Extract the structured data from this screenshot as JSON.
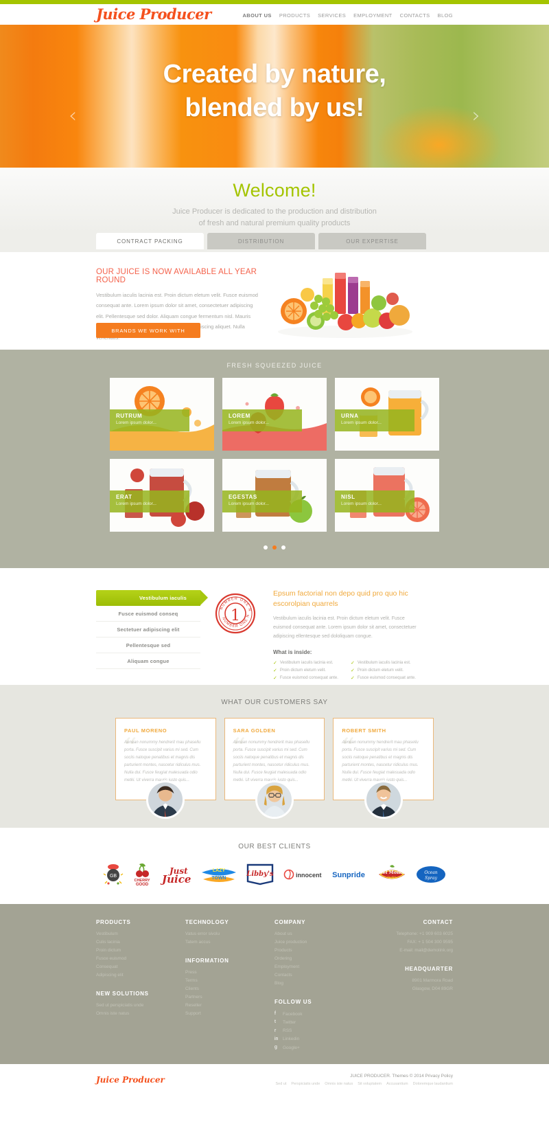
{
  "header": {
    "logo": "Juice Producer",
    "nav": [
      {
        "label": "ABOUT US",
        "active": true
      },
      {
        "label": "PRODUCTS"
      },
      {
        "label": "SERVICES"
      },
      {
        "label": "EMPLOYMENT"
      },
      {
        "label": "CONTACTS"
      },
      {
        "label": "BLOG"
      }
    ]
  },
  "hero": {
    "line1": "Created by nature,",
    "line2": "blended by us!",
    "prev": "‹",
    "next": "›"
  },
  "welcome": {
    "title": "Welcome!",
    "line1": "Juice Producer is dedicated to the production and distribution",
    "line2": "of fresh and natural premium quality products"
  },
  "tabs": [
    {
      "label": "CONTRACT PACKING",
      "active": true
    },
    {
      "label": "DISTRIBUTION",
      "active": false
    },
    {
      "label": "OUR EXPERTISE",
      "active": false
    }
  ],
  "intro": {
    "heading": "OUR JUICE IS NOW AVAILABLE ALL YEAR ROUND",
    "body": "Vestibulum iaculis lacinia est. Proin dictum eletum velit. Fusce euismod consequat ante. Lorem ipsum dolor sit amet, consectetuer adipiscing elit. Pellentesque sed dolor. Aliquam congue fermentum nisl. Mauris asan nulla vel diam. Sed in lacus ut enim adipiscing aliquet. Nulla venenatis.",
    "button": "BRANDS WE WORK WITH"
  },
  "gallery": {
    "title": "FRESH SQUEEZED JUICE",
    "items": [
      {
        "title": "RUTRUM",
        "sub": "Lorem ipsum dolor..."
      },
      {
        "title": "LOREM",
        "sub": "Lorem ipsum dolor..."
      },
      {
        "title": "URNA",
        "sub": "Lorem ipsum dolor..."
      },
      {
        "title": "ERAT",
        "sub": "Lorem ipsum dolor..."
      },
      {
        "title": "EGESTAS",
        "sub": "Lorem ipsum dolor..."
      },
      {
        "title": "NISL",
        "sub": "Lorem ipsum dolor..."
      }
    ],
    "dots": 3,
    "active_dot": 1
  },
  "features": {
    "list": [
      {
        "label": "Vestibulum iaculis",
        "active": true
      },
      {
        "label": "Fusce euismod conseq",
        "active": false
      },
      {
        "label": "Sectetuer adipiscing elit",
        "active": false
      },
      {
        "label": "Pellentesque sed",
        "active": false
      },
      {
        "label": "Aliquam congue",
        "active": false
      }
    ],
    "badge_number": "1",
    "badge_text": "NUMBER ONE",
    "heading": "Epsum factorial non depo quid pro quo hic escorolpian quarrels",
    "body": "Vestibulum iaculis lacinia est. Proin dictum eletum velit. Fusce euismod consequat ante. Lorem ipsum dolor sit amet, consectetuer adipiscing ellentesque sed dololiquam congue.",
    "inside_title": "What is inside:",
    "checks": [
      "Vestibulum iaculis lacinia est.",
      "Vestibulum iaculis lacinia est.",
      "Proin dictum eletum velit.",
      "Proin dictum eletum velit.",
      "Fusce euismod consequat ante.",
      "Fusce euismod consequat ante."
    ]
  },
  "testimonials": {
    "title": "WHAT OUR CUSTOMERS SAY",
    "items": [
      {
        "name": "PAUL MORENO",
        "text": "Aenean nonummy hendrerit mau phasellu porta. Fusce suscipit varius mi sed. Cum sociis natoque penatibus et magnis dis parturient montes, nascetur ridiculus mus. Nulla dui. Fusce feugiat malesuada odio metki. Ut viverra mauris justo quis..."
      },
      {
        "name": "SARA GOLDEN",
        "text": "Aenean nonummy hendrerit mau phasellu porta. Fusce suscipit varius mi sed. Cum sociis natoque penatibus et magnis dis parturient montes, nascetur ridiculus mus. Nulla dui. Fusce feugiat malesuada odio metki. Ut viverra mauris justo quis..."
      },
      {
        "name": "ROBERT SMITH",
        "text": "Aenean nonummy hendrerit mau phasellu porta. Fusce suscipit varius mi sed. Cum sociis natoque penatibus et magnis dis parturient montes, nascetur ridiculus mus. Nulla dui. Fusce feugiat malesuada odio metki. Ut viverra mauris justo quis..."
      }
    ]
  },
  "clients": {
    "title": "OUR BEST CLIENTS",
    "logos": [
      {
        "name": "GB"
      },
      {
        "name": "CHERRY GOOD"
      },
      {
        "name": "Just Juice"
      },
      {
        "name": "LAZY TOWN"
      },
      {
        "name": "Libby's"
      },
      {
        "name": "innocent"
      },
      {
        "name": "Sunpride"
      },
      {
        "name": "Del Monte"
      },
      {
        "name": "Ocean Spray"
      }
    ]
  },
  "footer": {
    "col1": {
      "title": "PRODUCTS",
      "links": [
        "Vestibulum",
        "Culis lacinia",
        "Proin dictum",
        "Fusce euismod",
        "Consequat",
        "Adipiscing elit"
      ],
      "title2": "NEW SOLUTIONS",
      "links2": [
        "Sed ut perspiciatis unde",
        "Omnis iste natus"
      ]
    },
    "col2": {
      "title": "TECHNOLOGY",
      "links": [
        "Vatus error sivolu",
        "Tatem accus"
      ],
      "title2": "INFORMATION",
      "links2": [
        "Press",
        "Terms",
        "Clients",
        "Partners",
        "Reseller",
        "Support"
      ]
    },
    "col3": {
      "title": "COMPANY",
      "links": [
        "About us",
        "Juice production",
        "Products",
        "Ordering",
        "Employment",
        "Contacts",
        "Blog"
      ],
      "title2": "FOLLOW US",
      "social": [
        {
          "icon": "f",
          "label": "Facebook"
        },
        {
          "icon": "t",
          "label": "Twitter"
        },
        {
          "icon": "r",
          "label": "RSS"
        },
        {
          "icon": "in",
          "label": "Linkedin"
        },
        {
          "icon": "g",
          "label": "Google+"
        }
      ]
    },
    "col4": {
      "title": "CONTACT",
      "lines": [
        "Telephone: +1 909 603 6025",
        "FAX: + 1 504 300 9595",
        "E-mail: mail@demolink.org"
      ],
      "title2": "HEADQUARTER",
      "lines2": [
        "8901 Marmora Road",
        "Glasgow, D04 89GR"
      ]
    }
  },
  "copyright": {
    "logo": "Juice Producer",
    "text": "JUICE PRODUCER. Themes © 2014 Privacy Policy",
    "small": [
      "Sed ut",
      "Perspiciatis unde",
      "Omnis iste natus",
      "Sit voluptatem",
      "Accusantium",
      "Doloremque laudantium"
    ]
  }
}
